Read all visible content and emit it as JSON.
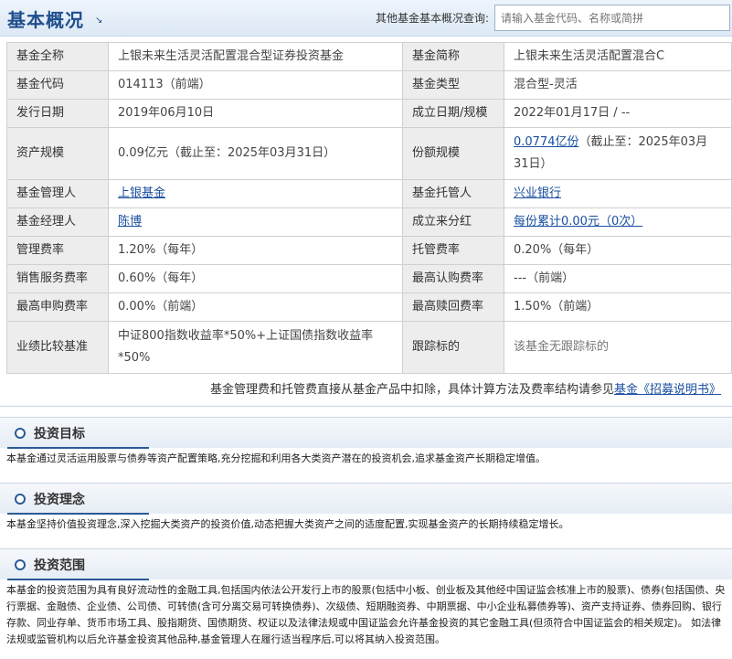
{
  "header": {
    "title": "基本概况",
    "title_arrow": "↘",
    "query_label": "其他基金基本概况查询:",
    "search_placeholder": "请输入基金代码、名称或简拼"
  },
  "info": {
    "full_name_label": "基金全称",
    "full_name": "上银未来生活灵活配置混合型证券投资基金",
    "short_name_label": "基金简称",
    "short_name": "上银未来生活灵活配置混合C",
    "code_label": "基金代码",
    "code": "014113（前端）",
    "type_label": "基金类型",
    "type": "混合型-灵活",
    "issue_date_label": "发行日期",
    "issue_date": "2019年06月10日",
    "established_label": "成立日期/规模",
    "established": "2022年01月17日 / --",
    "asset_size_label": "资产规模",
    "asset_size": "0.09亿元（截止至：2025年03月31日）",
    "share_size_label": "份额规模",
    "share_size_link": "0.0774亿份",
    "share_size_rest": "（截止至：2025年03月31日）",
    "manager_company_label": "基金管理人",
    "manager_company": "上银基金",
    "custodian_label": "基金托管人",
    "custodian": "兴业银行",
    "manager_label": "基金经理人",
    "manager": "陈博",
    "dividend_label": "成立来分红",
    "dividend": "每份累计0.00元（0次）",
    "mgmt_fee_label": "管理费率",
    "mgmt_fee": "1.20%（每年）",
    "custody_fee_label": "托管费率",
    "custody_fee": "0.20%（每年）",
    "sales_fee_label": "销售服务费率",
    "sales_fee": "0.60%（每年）",
    "max_subscribe_label": "最高认购费率",
    "max_subscribe": "---（前端）",
    "max_purchase_label": "最高申购费率",
    "max_purchase": "0.00%（前端）",
    "max_redeem_label": "最高赎回费率",
    "max_redeem": "1.50%（前端）",
    "benchmark_label": "业绩比较基准",
    "benchmark": "中证800指数收益率*50%+上证国债指数收益率*50%",
    "tracking_label": "跟踪标的",
    "tracking": "该基金无跟踪标的"
  },
  "note": {
    "text": "基金管理费和托管费直接从基金产品中扣除，具体计算方法及费率结构请参见",
    "link": "基金《招募说明书》"
  },
  "sections": {
    "goal_title": "投资目标",
    "goal_text": "本基金通过灵活运用股票与债券等资产配置策略,充分挖掘和利用各大类资产潜在的投资机会,追求基金资产长期稳定增值。",
    "idea_title": "投资理念",
    "idea_text": "本基金坚持价值投资理念,深入挖掘大类资产的投资价值,动态把握大类资产之间的适度配置,实现基金资产的长期持续稳定增长。",
    "scope_title": "投资范围",
    "scope_text": "本基金的投资范围为具有良好流动性的金融工具,包括国内依法公开发行上市的股票(包括中小板、创业板及其他经中国证监会核准上市的股票)、债券(包括国债、央行票据、金融债、企业债、公司债、可转债(含可分离交易可转换债券)、次级债、短期融资券、中期票据、中小企业私募债券等)、资产支持证券、债券回购、银行存款、同业存单、货币市场工具、股指期货、国债期货、权证以及法律法规或中国证监会允许基金投资的其它金融工具(但须符合中国证监会的相关规定)。 如法律法规或监管机构以后允许基金投资其他品种,基金管理人在履行适当程序后,可以将其纳入投资范围。"
  }
}
